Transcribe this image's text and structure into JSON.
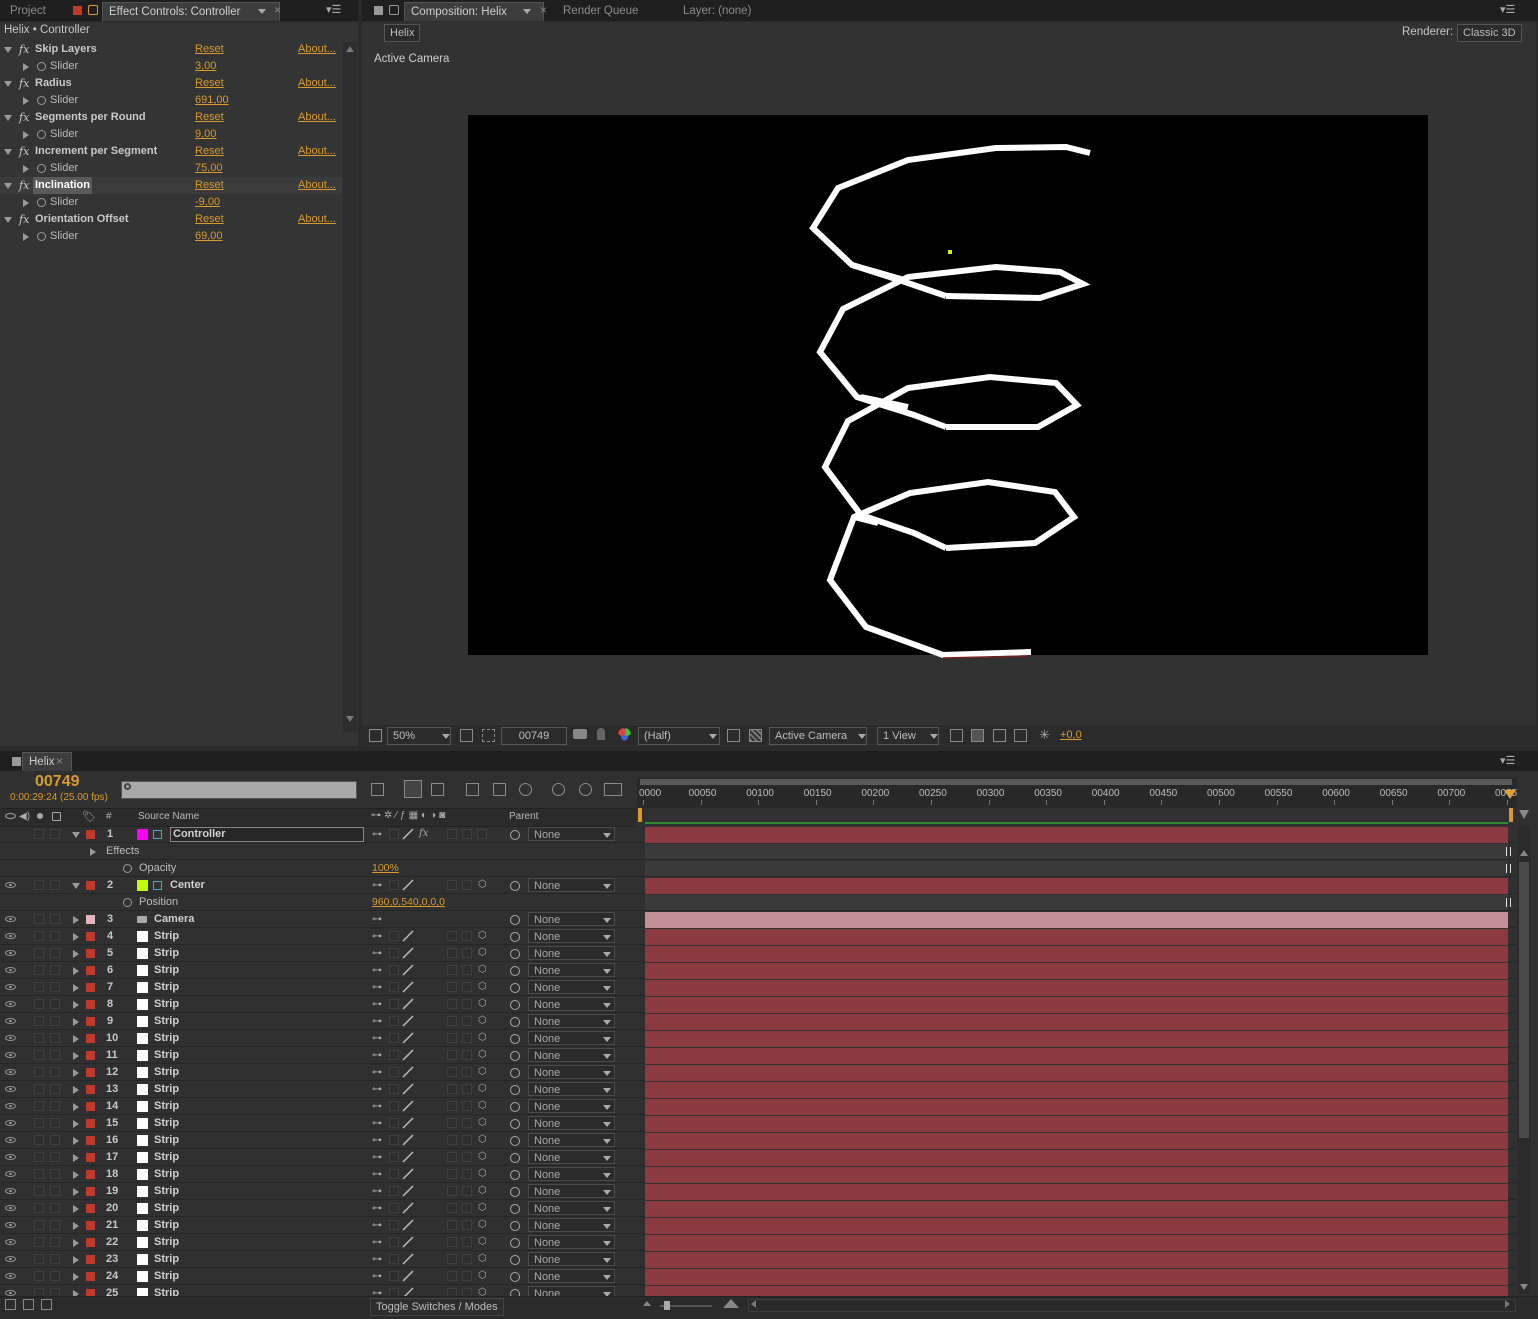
{
  "colors": {
    "accent_orange": "#d89b2b",
    "layer_bar": "#8b3a40",
    "camera_bar": "#c48e96",
    "controller_label": "#ff00ff",
    "center_label": "#bfff00",
    "strip_label": "#ffffff"
  },
  "top_left_tabs": {
    "project": "Project",
    "effect_controls": "Effect Controls: Controller"
  },
  "effect_controls": {
    "breadcrumb": "Helix • Controller",
    "reset_label": "Reset",
    "about_label": "About...",
    "fx_icon": "fx",
    "effects": [
      {
        "name": "Skip Layers",
        "param": "Slider",
        "value": "3,00"
      },
      {
        "name": "Radius",
        "param": "Slider",
        "value": "691,00"
      },
      {
        "name": "Segments per Round",
        "param": "Slider",
        "value": "9,00"
      },
      {
        "name": "Increment per Segment",
        "param": "Slider",
        "value": "75,00"
      },
      {
        "name": "Inclination",
        "param": "Slider",
        "value": "-9,00"
      },
      {
        "name": "Orientation Offset",
        "param": "Slider",
        "value": "69,00"
      }
    ]
  },
  "comp_tabs": {
    "composition": "Composition: Helix",
    "render_queue": "Render Queue",
    "layer": "Layer: (none)"
  },
  "comp_viewer": {
    "comp_button": "Helix",
    "renderer_label": "Renderer:",
    "renderer_value": "Classic 3D",
    "active_camera_label": "Active Camera"
  },
  "viewer_footer": {
    "zoom": "50%",
    "timecode": "00749",
    "resolution": "(Half)",
    "view": "Active Camera",
    "layout": "1 View",
    "exposure": "+0,0"
  },
  "timeline": {
    "tab": "Helix",
    "current_frame": "00749",
    "timecode": "0:00:29:24 (25.00 fps)",
    "col_num": "#",
    "col_source": "Source Name",
    "col_parent": "Parent",
    "ruler_labels": [
      "0000",
      "00050",
      "00100",
      "00150",
      "00200",
      "00250",
      "00300",
      "00350",
      "00400",
      "00450",
      "00500",
      "00550",
      "00600",
      "00650",
      "00700",
      "0075"
    ],
    "footer_toggle": "Toggle Switches / Modes",
    "none_label": "None",
    "rows": [
      {
        "kind": "layer",
        "num": "1",
        "name": "Controller",
        "label_color": "#ff00ff",
        "icon": "null-icon",
        "expanded": true,
        "fx": true,
        "cube": false,
        "bar": "layer"
      },
      {
        "kind": "group",
        "name": "Effects"
      },
      {
        "kind": "prop",
        "name": "Opacity",
        "value": "100%"
      },
      {
        "kind": "layer",
        "num": "2",
        "name": "Center",
        "label_color": "#bfff00",
        "icon": "null-icon",
        "expanded": true,
        "fx": false,
        "cube": true,
        "bar": "layer"
      },
      {
        "kind": "prop",
        "name": "Position",
        "value": "960,0,540,0,0,0"
      },
      {
        "kind": "layer",
        "num": "3",
        "name": "Camera",
        "label_color": null,
        "icon": "camera-icon",
        "expanded": false,
        "fx": false,
        "cube": false,
        "bar": "camera"
      },
      {
        "kind": "layer",
        "num": "4",
        "name": "Strip",
        "label_color": "#ffffff",
        "expanded": false,
        "cube": true,
        "bar": "layer"
      },
      {
        "kind": "layer",
        "num": "5",
        "name": "Strip",
        "label_color": "#ffffff",
        "expanded": false,
        "cube": true,
        "bar": "layer"
      },
      {
        "kind": "layer",
        "num": "6",
        "name": "Strip",
        "label_color": "#ffffff",
        "expanded": false,
        "cube": true,
        "bar": "layer"
      },
      {
        "kind": "layer",
        "num": "7",
        "name": "Strip",
        "label_color": "#ffffff",
        "expanded": false,
        "cube": true,
        "bar": "layer"
      },
      {
        "kind": "layer",
        "num": "8",
        "name": "Strip",
        "label_color": "#ffffff",
        "expanded": false,
        "cube": true,
        "bar": "layer"
      },
      {
        "kind": "layer",
        "num": "9",
        "name": "Strip",
        "label_color": "#ffffff",
        "expanded": false,
        "cube": true,
        "bar": "layer"
      },
      {
        "kind": "layer",
        "num": "10",
        "name": "Strip",
        "label_color": "#ffffff",
        "expanded": false,
        "cube": true,
        "bar": "layer"
      },
      {
        "kind": "layer",
        "num": "11",
        "name": "Strip",
        "label_color": "#ffffff",
        "expanded": false,
        "cube": true,
        "bar": "layer"
      },
      {
        "kind": "layer",
        "num": "12",
        "name": "Strip",
        "label_color": "#ffffff",
        "expanded": false,
        "cube": true,
        "bar": "layer"
      },
      {
        "kind": "layer",
        "num": "13",
        "name": "Strip",
        "label_color": "#ffffff",
        "expanded": false,
        "cube": true,
        "bar": "layer"
      },
      {
        "kind": "layer",
        "num": "14",
        "name": "Strip",
        "label_color": "#ffffff",
        "expanded": false,
        "cube": true,
        "bar": "layer"
      },
      {
        "kind": "layer",
        "num": "15",
        "name": "Strip",
        "label_color": "#ffffff",
        "expanded": false,
        "cube": true,
        "bar": "layer"
      },
      {
        "kind": "layer",
        "num": "16",
        "name": "Strip",
        "label_color": "#ffffff",
        "expanded": false,
        "cube": true,
        "bar": "layer"
      },
      {
        "kind": "layer",
        "num": "17",
        "name": "Strip",
        "label_color": "#ffffff",
        "expanded": false,
        "cube": true,
        "bar": "layer"
      },
      {
        "kind": "layer",
        "num": "18",
        "name": "Strip",
        "label_color": "#ffffff",
        "expanded": false,
        "cube": true,
        "bar": "layer"
      },
      {
        "kind": "layer",
        "num": "19",
        "name": "Strip",
        "label_color": "#ffffff",
        "expanded": false,
        "cube": true,
        "bar": "layer"
      },
      {
        "kind": "layer",
        "num": "20",
        "name": "Strip",
        "label_color": "#ffffff",
        "expanded": false,
        "cube": true,
        "bar": "layer"
      },
      {
        "kind": "layer",
        "num": "21",
        "name": "Strip",
        "label_color": "#ffffff",
        "expanded": false,
        "cube": true,
        "bar": "layer"
      },
      {
        "kind": "layer",
        "num": "22",
        "name": "Strip",
        "label_color": "#ffffff",
        "expanded": false,
        "cube": true,
        "bar": "layer"
      },
      {
        "kind": "layer",
        "num": "23",
        "name": "Strip",
        "label_color": "#ffffff",
        "expanded": false,
        "cube": true,
        "bar": "layer"
      },
      {
        "kind": "layer",
        "num": "24",
        "name": "Strip",
        "label_color": "#ffffff",
        "expanded": false,
        "cube": true,
        "bar": "layer"
      },
      {
        "kind": "layer",
        "num": "25",
        "name": "Strip",
        "label_color": "#ffffff",
        "expanded": false,
        "cube": true,
        "bar": "layer"
      }
    ]
  }
}
